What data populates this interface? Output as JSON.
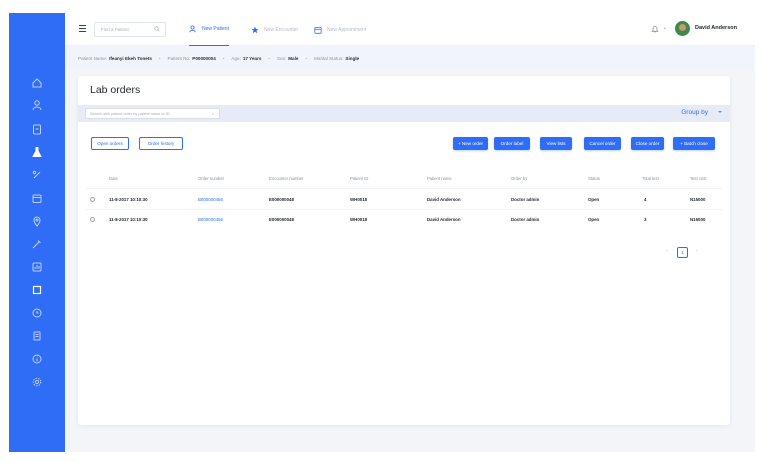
{
  "topbar": {
    "search_placeholder": "Find a Patient",
    "tabs": [
      {
        "label": "New Patient",
        "icon": "user-plus-icon"
      },
      {
        "label": "New Encounter",
        "icon": "star-icon"
      },
      {
        "label": "New Appointment",
        "icon": "calendar-icon"
      }
    ],
    "dot_menu": "•",
    "user_name": "David Anderson"
  },
  "patient": {
    "name_label": "Patient Name:",
    "name_value": "Ifeanyi Ekeh Tonets",
    "no_label": "Patient No:",
    "no_value": "P00000004",
    "age_label": "Age:",
    "age_value": "17 Years",
    "sex_label": "Sex:",
    "sex_value": "Male",
    "marital_label": "Marital Status:",
    "marital_value": "Single"
  },
  "page": {
    "title": "Lab orders",
    "search_placeholder": "Search with patient order by patient name or ID",
    "search_clear": "×",
    "group_by": "Group by"
  },
  "toolbar": {
    "open_orders": "Open orders",
    "order_history": "Order history",
    "new_order": "+ New order",
    "order_label": "Order label",
    "view_lists": "View lists",
    "cancel_order": "Cancel order",
    "close_order": "Close order",
    "batch_close": "+ Batch close"
  },
  "table": {
    "headers": [
      "Date",
      "Order number",
      "Encounter number",
      "Patient ID",
      "Patient name",
      "Order by",
      "Status",
      "Total test",
      "Test cost"
    ],
    "rows": [
      [
        "11-8-2017   10:10:30",
        "B000000456",
        "E000000048",
        "WH0018",
        "David Anderson",
        "Doctor admin",
        "Open",
        "4",
        "N15000"
      ],
      [
        "11-8-2017   10:10:30",
        "B000000456",
        "E000000048",
        "WH0018",
        "David Anderson",
        "Doctor admin",
        "Open",
        "3",
        "N15000"
      ]
    ]
  },
  "pagination": {
    "prev": "‹",
    "current": "1",
    "next": "›"
  },
  "colors": {
    "accent": "#2f6df6",
    "sidebar": "#2f6df6",
    "background": "#f3f5f9"
  }
}
